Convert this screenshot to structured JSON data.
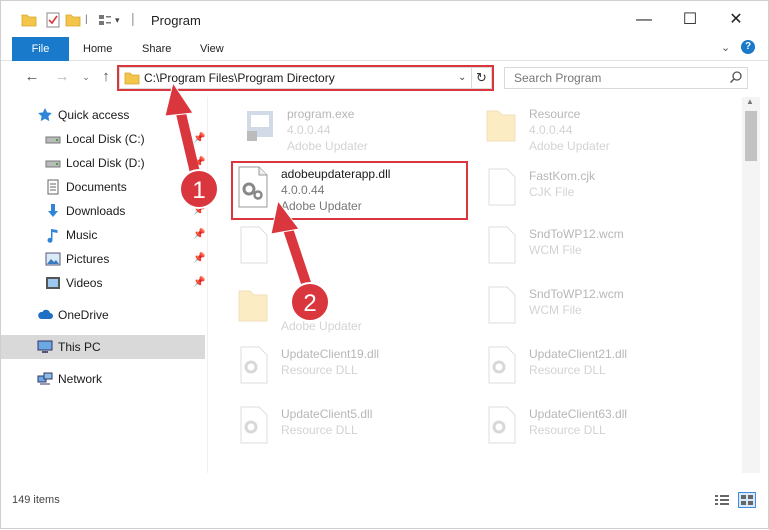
{
  "window": {
    "title": "Program",
    "minimize": "—",
    "maximize": "☐",
    "close": "✕"
  },
  "ribbon": {
    "tabs": [
      "File",
      "Home",
      "Share",
      "View"
    ]
  },
  "address": {
    "path": "C:\\Program Files\\Program Directory",
    "search_placeholder": "Search Program"
  },
  "sidebar": {
    "items": [
      {
        "label": "Quick access",
        "icon": "star-icon"
      },
      {
        "label": "Local Disk (C:)",
        "icon": "drive-icon",
        "pinned": true
      },
      {
        "label": "Local Disk (D:)",
        "icon": "drive-icon",
        "pinned": true
      },
      {
        "label": "Documents",
        "icon": "documents-icon",
        "pinned": true
      },
      {
        "label": "Downloads",
        "icon": "download-icon",
        "pinned": true
      },
      {
        "label": "Music",
        "icon": "music-icon",
        "pinned": true
      },
      {
        "label": "Pictures",
        "icon": "pictures-icon",
        "pinned": true
      },
      {
        "label": "Videos",
        "icon": "videos-icon",
        "pinned": true
      },
      {
        "label": "OneDrive",
        "icon": "cloud-icon"
      },
      {
        "label": "This PC",
        "icon": "computer-icon",
        "selected": true
      },
      {
        "label": "Network",
        "icon": "network-icon"
      }
    ]
  },
  "files": [
    {
      "name": "program.exe",
      "line2": "4.0.0.44",
      "line3": "Adobe Updater"
    },
    {
      "name": "Resource",
      "line2": "4.0.0.44",
      "line3": "Adobe Updater"
    },
    {
      "name": "adobeupdaterapp.dll",
      "line2": "4.0.0.44",
      "line3": "Adobe Updater"
    },
    {
      "name": "FastKom.cjk",
      "line2": "CJK File"
    },
    {
      "name": "",
      "line2": ""
    },
    {
      "name": "SndToWP12.wcm",
      "line2": "WCM File"
    },
    {
      "name": "",
      "line2": "",
      "line3": "Adobe Updater"
    },
    {
      "name": "SndToWP12.wcm",
      "line2": "WCM File"
    },
    {
      "name": "UpdateClient19.dll",
      "line2": "Resource DLL"
    },
    {
      "name": "UpdateClient21.dll",
      "line2": "Resource DLL"
    },
    {
      "name": "UpdateClient5.dll",
      "line2": "Resource DLL"
    },
    {
      "name": "UpdateClient63.dll",
      "line2": "Resource DLL"
    }
  ],
  "status": {
    "count": "149 items"
  },
  "callouts": [
    "1",
    "2"
  ],
  "colors": {
    "accent": "#1979ca",
    "highlight": "#d9363e"
  }
}
